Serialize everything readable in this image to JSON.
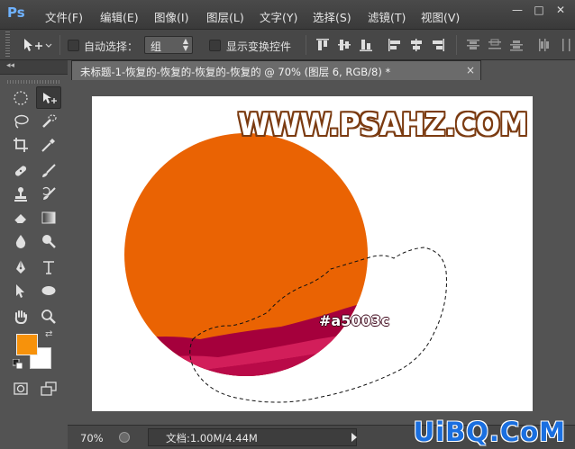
{
  "app": {
    "logo": "Ps",
    "menu": [
      "文件(F)",
      "编辑(E)",
      "图像(I)",
      "图层(L)",
      "文字(Y)",
      "选择(S)",
      "滤镜(T)",
      "视图(V)"
    ],
    "window_buttons": [
      "—",
      "□",
      "✕"
    ]
  },
  "options": {
    "auto_select_label": "自动选择：",
    "auto_select_value": "组",
    "show_transform_label": "显示变换控件"
  },
  "toolbox": {
    "collapse": "◂◂",
    "foreground_color": "#f7920b",
    "background_color": "#ffffff"
  },
  "document": {
    "tab_title": "未标题-1-恢复的-恢复的-恢复的-恢复的 @ 70% (图层 6, RGB/8) *",
    "close": "×"
  },
  "canvas": {
    "logo_text": "WWW.PSAHZ.COM",
    "color_label": "#a5003c",
    "circle_color": "#ea6303",
    "wave_colors": [
      "#a5003c",
      "#d21e5a",
      "#b90a48"
    ]
  },
  "status": {
    "zoom": "70%",
    "doc_info": "文档:1.00M/4.44M"
  },
  "watermark": "UiBQ.CoM"
}
